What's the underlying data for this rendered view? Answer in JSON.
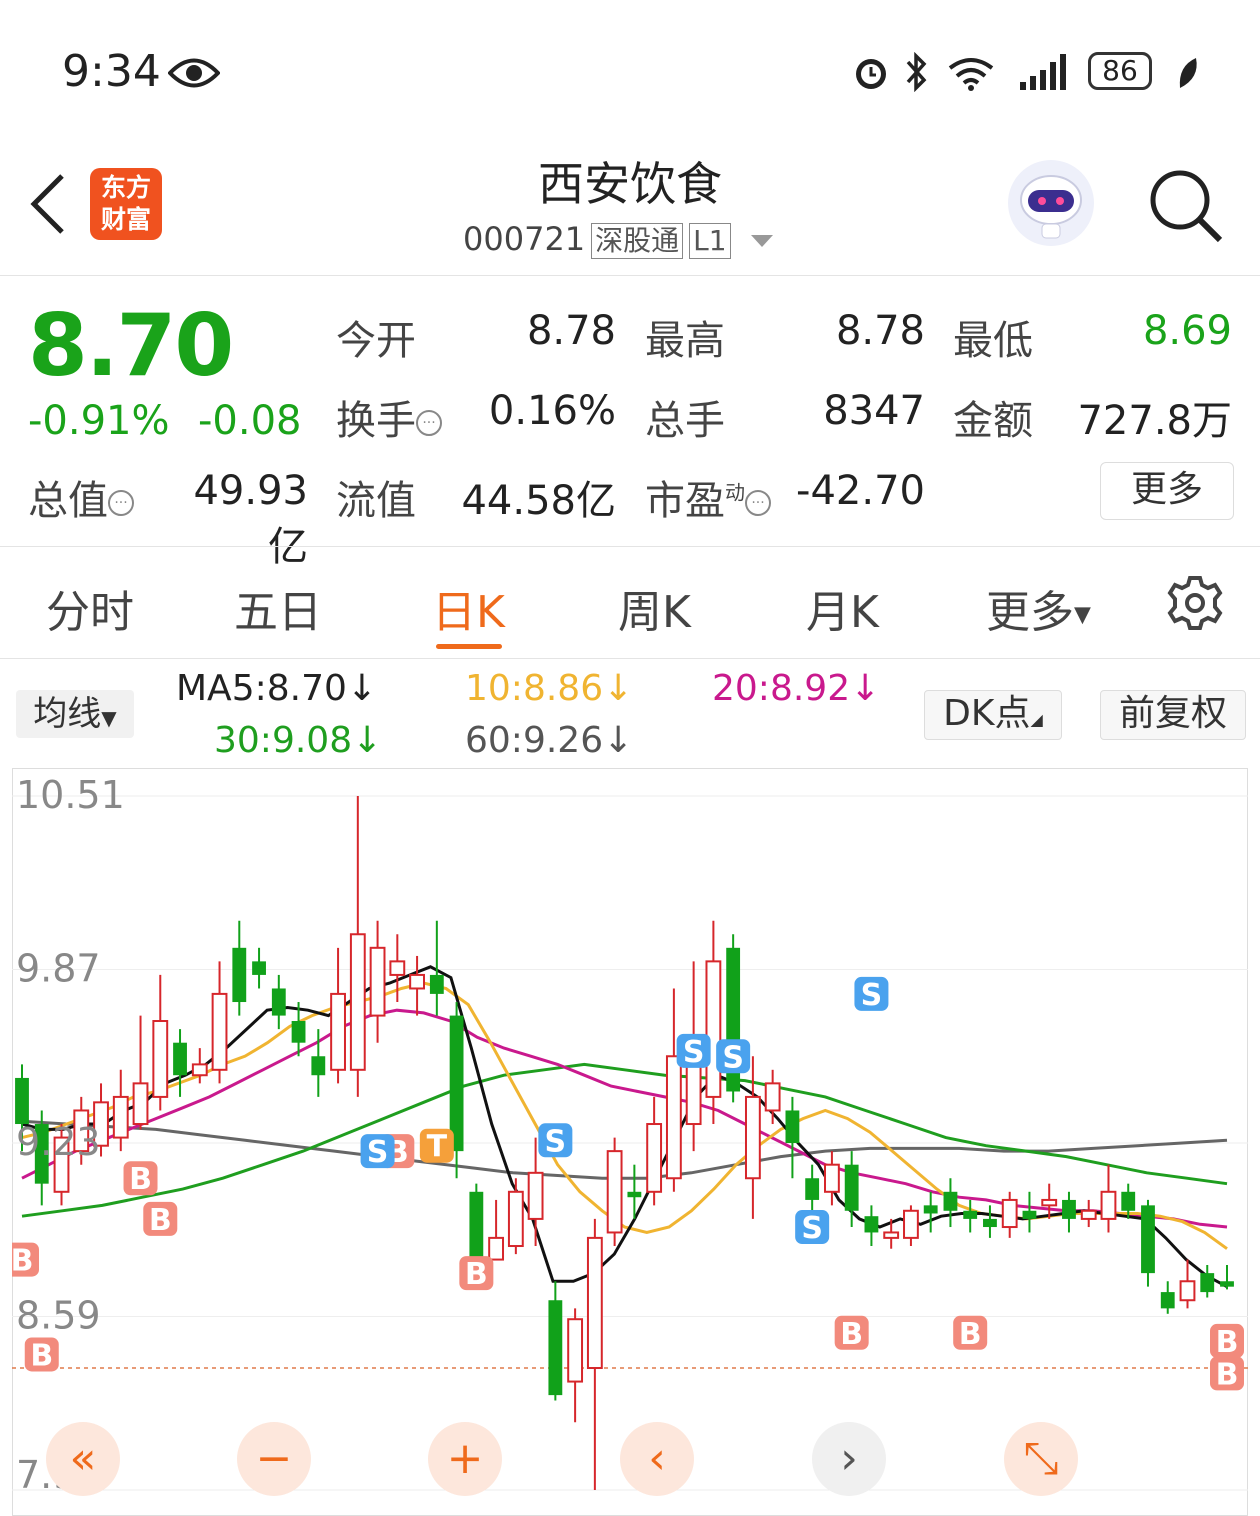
{
  "status": {
    "time": "9:34",
    "battery": "86"
  },
  "header": {
    "logo_line1": "东方",
    "logo_line2": "财富",
    "stock_name": "西安饮食",
    "code": "000721",
    "tag1": "深股通",
    "tag2": "L1"
  },
  "quote": {
    "price": "8.70",
    "change_pct": "-0.91%",
    "change": "-0.08",
    "open_label": "今开",
    "open": "8.78",
    "high_label": "最高",
    "high": "8.78",
    "low_label": "最低",
    "low": "8.69",
    "turnover_label": "换手",
    "turnover": "0.16%",
    "volume_label": "总手",
    "volume": "8347",
    "amount_label": "金额",
    "amount": "727.8万",
    "mktcap_label": "总值",
    "mktcap": "49.93亿",
    "float_label": "流值",
    "float": "44.58亿",
    "pe_label": "市盈",
    "pe_sup": "动",
    "pe": "-42.70",
    "more": "更多"
  },
  "tabs": [
    "分时",
    "五日",
    "日K",
    "周K",
    "月K",
    "更多"
  ],
  "active_tab": "日K",
  "ma_bar": {
    "selector": "均线",
    "ma5": "MA5:8.70↓",
    "ma10": "10:8.86↓",
    "ma20": "20:8.92↓",
    "ma30": "30:9.08↓",
    "ma60": "60:9.26↓",
    "dk": "DK点",
    "adjust": "前复权"
  },
  "colors": {
    "accent": "#ef6a1b",
    "up": "#d6262b",
    "down": "#11a11a",
    "ma5": "#111111",
    "ma10": "#f0b431",
    "ma20": "#c9198d",
    "ma30": "#1f9e1f",
    "ma60": "#666666"
  },
  "chart_data": {
    "type": "candlestick",
    "yticks": [
      "10.51",
      "9.87",
      "9.23",
      "8.59",
      "7.95"
    ],
    "ylim": [
      7.95,
      10.51
    ],
    "last_price": 8.7,
    "candles": [
      [
        9.47,
        9.3,
        9.52,
        9.2
      ],
      [
        9.3,
        9.08,
        9.35,
        9.0
      ],
      [
        9.05,
        9.25,
        9.3,
        9.0
      ],
      [
        9.2,
        9.35,
        9.4,
        9.15
      ],
      [
        9.22,
        9.38,
        9.45,
        9.18
      ],
      [
        9.25,
        9.4,
        9.5,
        9.2
      ],
      [
        9.3,
        9.45,
        9.7,
        9.28
      ],
      [
        9.4,
        9.68,
        9.85,
        9.35
      ],
      [
        9.6,
        9.48,
        9.65,
        9.4
      ],
      [
        9.48,
        9.52,
        9.58,
        9.45
      ],
      [
        9.5,
        9.78,
        9.9,
        9.45
      ],
      [
        9.95,
        9.75,
        10.05,
        9.7
      ],
      [
        9.9,
        9.85,
        9.95,
        9.8
      ],
      [
        9.8,
        9.7,
        9.85,
        9.65
      ],
      [
        9.68,
        9.6,
        9.75,
        9.55
      ],
      [
        9.55,
        9.48,
        9.65,
        9.4
      ],
      [
        9.5,
        9.78,
        9.95,
        9.45
      ],
      [
        9.5,
        10.0,
        10.51,
        9.4
      ],
      [
        9.7,
        9.95,
        10.05,
        9.6
      ],
      [
        9.85,
        9.9,
        10.0,
        9.75
      ],
      [
        9.8,
        9.85,
        9.92,
        9.7
      ],
      [
        9.85,
        9.78,
        10.05,
        9.7
      ],
      [
        9.7,
        9.2,
        9.75,
        9.1
      ],
      [
        9.05,
        8.8,
        9.08,
        8.75
      ],
      [
        8.8,
        8.88,
        9.02,
        8.8
      ],
      [
        8.85,
        9.05,
        9.1,
        8.82
      ],
      [
        8.95,
        9.12,
        9.25,
        8.85
      ],
      [
        8.65,
        8.3,
        8.72,
        8.28
      ],
      [
        8.35,
        8.58,
        8.62,
        8.2
      ],
      [
        8.4,
        8.88,
        8.95,
        7.95
      ],
      [
        8.9,
        9.2,
        9.25,
        8.85
      ],
      [
        9.05,
        9.03,
        9.15,
        8.95
      ],
      [
        9.05,
        9.3,
        9.4,
        9.0
      ],
      [
        9.1,
        9.55,
        9.8,
        9.05
      ],
      [
        9.3,
        9.62,
        9.9,
        9.2
      ],
      [
        9.4,
        9.9,
        10.05,
        9.3
      ],
      [
        9.95,
        9.42,
        10.0,
        9.38
      ],
      [
        9.1,
        9.4,
        9.55,
        8.95
      ],
      [
        9.35,
        9.45,
        9.5,
        9.3
      ],
      [
        9.35,
        9.23,
        9.4,
        9.1
      ],
      [
        9.1,
        9.02,
        9.15,
        8.98
      ],
      [
        9.05,
        9.15,
        9.2,
        9.0
      ],
      [
        9.15,
        8.98,
        9.2,
        8.92
      ],
      [
        8.96,
        8.9,
        9.0,
        8.85
      ],
      [
        8.88,
        8.9,
        8.95,
        8.84
      ],
      [
        8.88,
        8.98,
        9.0,
        8.85
      ],
      [
        9.0,
        8.97,
        9.05,
        8.9
      ],
      [
        9.05,
        8.98,
        9.1,
        8.92
      ],
      [
        8.98,
        8.95,
        9.02,
        8.9
      ],
      [
        8.95,
        8.92,
        9.0,
        8.88
      ],
      [
        8.92,
        9.02,
        9.05,
        8.88
      ],
      [
        8.98,
        8.95,
        9.05,
        8.9
      ],
      [
        9.0,
        9.02,
        9.08,
        8.95
      ],
      [
        9.02,
        8.95,
        9.05,
        8.9
      ],
      [
        8.95,
        8.98,
        9.02,
        8.92
      ],
      [
        8.95,
        9.05,
        9.15,
        8.9
      ],
      [
        9.05,
        8.98,
        9.08,
        8.95
      ],
      [
        9.0,
        8.75,
        9.02,
        8.7
      ],
      [
        8.68,
        8.62,
        8.72,
        8.6
      ],
      [
        8.65,
        8.72,
        8.8,
        8.62
      ],
      [
        8.75,
        8.68,
        8.78,
        8.66
      ],
      [
        8.72,
        8.7,
        8.78,
        8.69
      ]
    ],
    "ma_lines": {
      "ma5": [
        9.3,
        9.28,
        9.28,
        9.3,
        9.3,
        9.35,
        9.38,
        9.45,
        9.48,
        9.52,
        9.58,
        9.65,
        9.72,
        9.73,
        9.72,
        9.7,
        9.75,
        9.8,
        9.82,
        9.85,
        9.88,
        9.84,
        9.58,
        9.3,
        9.08,
        8.95,
        8.72,
        8.72,
        8.75,
        8.82,
        8.95,
        9.1,
        9.25,
        9.4,
        9.48,
        9.45,
        9.4,
        9.32,
        9.23,
        9.15,
        9.02,
        8.95,
        8.92,
        8.95,
        8.93,
        8.96,
        8.97,
        8.97,
        8.96,
        8.95,
        8.96,
        8.97,
        8.98,
        8.97,
        8.96,
        8.95,
        8.88,
        8.8,
        8.74,
        8.7
      ],
      "ma10": [
        9.25,
        9.27,
        9.3,
        9.33,
        9.36,
        9.4,
        9.42,
        9.45,
        9.48,
        9.52,
        9.55,
        9.6,
        9.66,
        9.7,
        9.73,
        9.75,
        9.77,
        9.8,
        9.82,
        9.8,
        9.74,
        9.6,
        9.45,
        9.3,
        9.15,
        9.05,
        8.98,
        8.92,
        8.9,
        8.92,
        8.98,
        9.06,
        9.15,
        9.22,
        9.28,
        9.32,
        9.35,
        9.32,
        9.27,
        9.2,
        9.13,
        9.06,
        9.0,
        8.97,
        8.96,
        8.95,
        8.96,
        8.97,
        8.97,
        8.97,
        8.97,
        8.96,
        8.94,
        8.9,
        8.84
      ],
      "ma20": [
        9.1,
        9.15,
        9.2,
        9.24,
        9.28,
        9.32,
        9.36,
        9.4,
        9.45,
        9.5,
        9.55,
        9.6,
        9.66,
        9.7,
        9.72,
        9.71,
        9.68,
        9.62,
        9.58,
        9.55,
        9.52,
        9.48,
        9.44,
        9.42,
        9.4,
        9.38,
        9.35,
        9.3,
        9.25,
        9.2,
        9.15,
        9.12,
        9.1,
        9.08,
        9.05,
        9.03,
        9.02,
        9.0,
        8.99,
        8.98,
        8.98,
        8.97,
        8.96,
        8.95,
        8.93,
        8.92
      ],
      "ma30": [
        8.96,
        8.98,
        9.0,
        9.03,
        9.06,
        9.1,
        9.15,
        9.2,
        9.26,
        9.32,
        9.38,
        9.44,
        9.48,
        9.5,
        9.52,
        9.5,
        9.48,
        9.47,
        9.46,
        9.43,
        9.4,
        9.35,
        9.3,
        9.25,
        9.22,
        9.2,
        9.18,
        9.15,
        9.12,
        9.1,
        9.08
      ],
      "ma60": [
        9.31,
        9.3,
        9.29,
        9.28,
        9.26,
        9.24,
        9.22,
        9.2,
        9.18,
        9.16,
        9.14,
        9.12,
        9.11,
        9.1,
        9.1,
        9.12,
        9.15,
        9.18,
        9.2,
        9.21,
        9.21,
        9.21,
        9.2,
        9.2,
        9.21,
        9.22,
        9.23,
        9.24
      ]
    }
  }
}
